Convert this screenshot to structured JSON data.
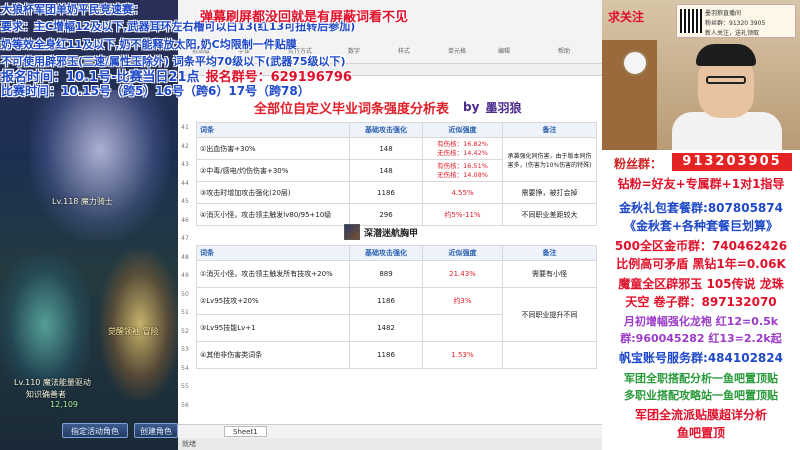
{
  "overlay": {
    "line1": "大狼杯军团单奶平民竞速赛：",
    "line2": "要求：主C增幅12及以下,武器耳环左右槽可以白13(红13可扭转后参加)",
    "line3": "奶等效全身红11及以下,奶不能释放太阳,奶C均限制一件贴膜",
    "line4": "不可使用辟邪玉(三速/属性玉除外) 词条平均70级以下(武器75级以下)",
    "line5": "报名时间：10.1号-比赛当日21点",
    "line5_group": "报名群号：629196796",
    "line6": "比赛时间：10.15号（跨5）16号（跨6）17号（跨78）",
    "danmu": "弹幕刷屏都没回就是有屏蔽词看不见"
  },
  "spreadsheet": {
    "title": "全部位自定义毕业词条强度分析表",
    "by": "by",
    "author": "墨羽狼",
    "row_numbers": [
      "41",
      "42",
      "43",
      "44",
      "45",
      "46",
      "47",
      "48",
      "49",
      "50",
      "51",
      "52",
      "53",
      "54",
      "55",
      "56"
    ],
    "columns": [
      "词条",
      "基础攻击强化",
      "近似强度",
      "备注"
    ],
    "table1": [
      {
        "name": "①出血伤害+30%",
        "base": "148",
        "pct_lines": [
          "有伤核：16.82%",
          "无伤核：14.42%"
        ],
        "note": ""
      },
      {
        "name": "②中毒/感电/灼伤伤害+30%",
        "base": "148",
        "pct_lines": [
          "有伤核：16.51%",
          "无伤核：14.08%"
        ],
        "note": "承袭强化同伤害，由于版本同伤害多，(伤害为10%伤害的特殊)"
      },
      {
        "name": "③攻击时增加攻击强化(20层)",
        "base": "1186",
        "pct_lines": [
          "4.55%"
        ],
        "note": "需要挣，被打会掉"
      },
      {
        "name": "④消灭小怪，攻击领主触发lv80/95+10级",
        "base": "296",
        "pct_lines": [
          "约5%-11%"
        ],
        "note": "不同职业差距较大"
      }
    ],
    "section2_title": "深潜迷航胸甲",
    "table2": [
      {
        "name": "①消灭小怪，攻击领主触发所有技攻+20%",
        "base": "889",
        "pct_lines": [
          "21.43%"
        ],
        "note": "需要有小怪"
      },
      {
        "name": "②Lv95技攻+20%",
        "base": "1186",
        "pct_lines": [
          "约3%"
        ],
        "note": "不同职业提升不同"
      },
      {
        "name": "③Lv95技能Lv+1",
        "base": "1482",
        "pct_lines": [
          ""
        ],
        "note": ""
      },
      {
        "name": "④其他非伤害类词条",
        "base": "1186",
        "pct_lines": [
          "1.53%"
        ],
        "note": ""
      }
    ],
    "sheet_tab": "Sheet1",
    "status_text": "就绪",
    "ribbon_items": [
      "剪贴板",
      "字体",
      "对齐方式",
      "数字",
      "样式",
      "单元格",
      "编辑",
      "帮助"
    ]
  },
  "game": {
    "char1_level": "Lv.118 魔力骑士",
    "char2_level": "Lv.110 魔法能量驱动",
    "char2_name": "知识确善者",
    "char2_num": "12,109",
    "char3_name": "觉醒领袖 冒险",
    "btn1": "指定活动角色",
    "btn2": "创建角色"
  },
  "streamer": {
    "caption": "求关注",
    "promo_line1": "墨羽狼直播间",
    "promo_line2": "粉丝群：91320 3905",
    "promo_line3": "新人关注，送礼领取",
    "fan_label": "粉丝群：",
    "fan_number": "913203905",
    "lines": [
      "钻粉=好友+专属群+1对1指导",
      "金秋礼包套餐群:807805874",
      "《金秋套+各种套餐巨划算》",
      "500全区金币群：740462426",
      "比例高可矛盾  黑钻1年=0.06K",
      "魔童全区辟邪玉 105传说 龙珠",
      "天空  卷子群：897132070",
      "月初增幅强化龙袍  红12=0.5k",
      "群:960045282    红13=2.2k起",
      "帆宝账号服务群:484102824",
      "军团全职搭配分析一鱼吧置顶贴",
      "多职业搭配攻略站一鱼吧置顶贴",
      "军团全流派贴膜超详分析",
      "鱼吧置顶"
    ]
  },
  "colors": {
    "red": "#e0102a",
    "blue": "#1e48c8",
    "purple": "#4b2a8a"
  }
}
